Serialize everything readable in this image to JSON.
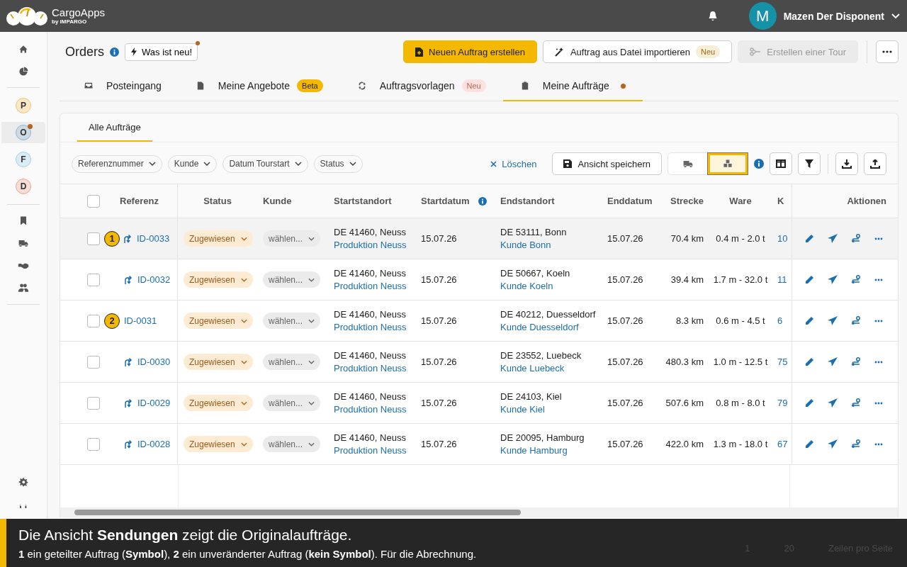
{
  "topbar": {
    "logo_name": "CargoApps",
    "logo_sub": "by IMPARGO",
    "avatar_letter": "M",
    "user_name": "Mazen Der Disponent"
  },
  "sidebar": {
    "workspaces": [
      {
        "letter": "P",
        "color": "#f5c76b",
        "selected": false,
        "dot": false
      },
      {
        "letter": "O",
        "color": "#8fb8d6",
        "selected": true,
        "dot": true
      },
      {
        "letter": "F",
        "color": "#9fd3ea",
        "selected": false,
        "dot": false
      },
      {
        "letter": "D",
        "color": "#f0a58f",
        "selected": false,
        "dot": false
      }
    ]
  },
  "header": {
    "title": "Orders",
    "whats_new": "Was ist neu!",
    "whats_new_dot": true,
    "buttons": [
      {
        "label": "Neuen Auftrag erstellen",
        "kind": "primary",
        "disabled": false
      },
      {
        "label": "Auftrag aus Datei importieren",
        "kind": "import",
        "badge": "Neu",
        "disabled": false
      },
      {
        "label": "Erstellen einer Tour",
        "kind": "tour",
        "disabled": true
      }
    ]
  },
  "tabs": [
    {
      "label": "Posteingang",
      "selected": false
    },
    {
      "label": "Meine Angebote",
      "badge": "Beta",
      "selected": false
    },
    {
      "label": "Auftragsvorlagen",
      "badge": "Neu",
      "selected": false
    },
    {
      "label": "Meine Aufträge",
      "dot": true,
      "selected": true
    }
  ],
  "subtabs": [
    {
      "label": "Alle Aufträge",
      "selected": true
    }
  ],
  "filters": [
    "Referenznummer",
    "Kunde",
    "Datum Tourstart",
    "Status"
  ],
  "clear": "Löschen",
  "save_view": "Ansicht speichern",
  "views": [
    {
      "selected": false
    },
    {
      "selected": true
    }
  ],
  "select_all_checked": false,
  "columns": [
    "Referenz",
    "Status",
    "Kunde",
    "Startstandort",
    "Startdatum",
    "Endstandort",
    "Enddatum",
    "Strecke",
    "Ware",
    "K",
    "Aktionen"
  ],
  "rows": [
    {
      "checked": false,
      "marker": "1",
      "split": true,
      "ref": "ID-0033",
      "status": "Zugewiesen",
      "customer": "wählen...",
      "start": "DE 41460, Neuss",
      "start_site": "Produktion Neuss",
      "start_date": "15.07.26",
      "end": "DE 53111, Bonn",
      "end_site": "Kunde Bonn",
      "end_date": "15.07.26",
      "distance": "70.4 km",
      "goods": "0.4 m - 2.0 t",
      "col_k": "10",
      "hovered": true
    },
    {
      "checked": false,
      "split": true,
      "ref": "ID-0032",
      "status": "Zugewiesen",
      "customer": "wählen...",
      "start": "DE 41460, Neuss",
      "start_site": "Produktion Neuss",
      "start_date": "15.07.26",
      "end": "DE 50667, Koeln",
      "end_site": "Kunde Koeln",
      "end_date": "15.07.26",
      "distance": "39.4 km",
      "goods": "1.7 m - 32.0 t",
      "col_k": "11",
      "hovered": false
    },
    {
      "checked": false,
      "marker": "2",
      "split": false,
      "ref": "ID-0031",
      "status": "Zugewiesen",
      "customer": "wählen...",
      "start": "DE 41460, Neuss",
      "start_site": "Produktion Neuss",
      "start_date": "15.07.26",
      "end": "DE 40212, Duesseldorf",
      "end_site": "Kunde Duesseldorf",
      "end_date": "15.07.26",
      "distance": "8.3 km",
      "goods": "0.6 m - 4.5 t",
      "col_k": "6",
      "hovered": false
    },
    {
      "checked": false,
      "split": true,
      "ref": "ID-0030",
      "status": "Zugewiesen",
      "customer": "wählen...",
      "start": "DE 41460, Neuss",
      "start_site": "Produktion Neuss",
      "start_date": "15.07.26",
      "end": "DE 23552, Luebeck",
      "end_site": "Kunde Luebeck",
      "end_date": "15.07.26",
      "distance": "480.3 km",
      "goods": "1.0 m - 12.5 t",
      "col_k": "75",
      "hovered": false
    },
    {
      "checked": false,
      "split": true,
      "ref": "ID-0029",
      "status": "Zugewiesen",
      "customer": "wählen...",
      "start": "DE 41460, Neuss",
      "start_site": "Produktion Neuss",
      "start_date": "15.07.26",
      "end": "DE 24103, Kiel",
      "end_site": "Kunde Kiel",
      "end_date": "15.07.26",
      "distance": "507.6 km",
      "goods": "0.8 m - 8.0 t",
      "col_k": "79",
      "hovered": false
    },
    {
      "checked": false,
      "split": true,
      "ref": "ID-0028",
      "status": "Zugewiesen",
      "customer": "wählen...",
      "start": "DE 41460, Neuss",
      "start_site": "Produktion Neuss",
      "start_date": "15.07.26",
      "end": "DE 20095, Hamburg",
      "end_site": "Kunde Hamburg",
      "end_date": "15.07.26",
      "distance": "422.0 km",
      "goods": "1.3 m - 18.0 t",
      "col_k": "67",
      "hovered": false
    }
  ],
  "pagination": {
    "page": "1",
    "page_size": "20",
    "rows_label": "Zeilen pro Seite"
  },
  "caption": {
    "title": "Die Ansicht **Sendungen** zeigt die Originalaufträge.",
    "text": "**1** ein geteilter Auftrag (**Symbol**), **2** ein unveränderter Auftrag (**kein Symbol**). Für die Abrechnung."
  }
}
